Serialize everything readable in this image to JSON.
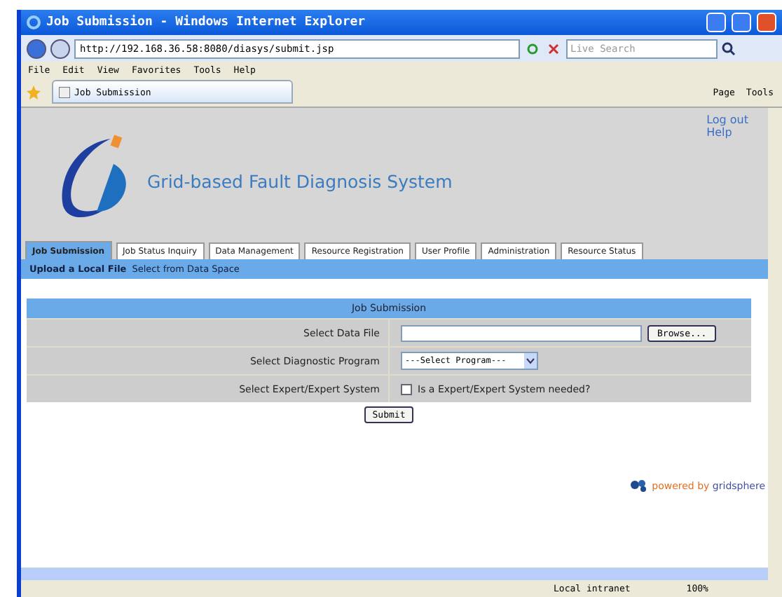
{
  "window": {
    "title": "Job Submission - Windows Internet Explorer"
  },
  "address_bar": {
    "url": "http://192.168.36.58:8080/diasys/submit.jsp",
    "search_placeholder": "Live Search"
  },
  "menu_bar": [
    "File",
    "Edit",
    "View",
    "Favorites",
    "Tools",
    "Help"
  ],
  "browser_tab": {
    "title": "Job Submission"
  },
  "command_bar": [
    {
      "label": "Page"
    },
    {
      "label": "Tools"
    }
  ],
  "page": {
    "title": "Grid-based Fault Diagnosis System",
    "links": [
      "Log out",
      "Help"
    ],
    "tabs": [
      {
        "label": "Job Submission",
        "selected": true
      },
      {
        "label": "Job Status Inquiry",
        "selected": false
      },
      {
        "label": "Data Management",
        "selected": false
      },
      {
        "label": "Resource Registration",
        "selected": false
      },
      {
        "label": "User Profile",
        "selected": false
      },
      {
        "label": "Administration",
        "selected": false
      },
      {
        "label": "Resource Status",
        "selected": false
      }
    ],
    "subtabs": [
      {
        "label": "Upload a Local File",
        "selected": true
      },
      {
        "label": "Select from Data Space",
        "selected": false
      }
    ],
    "form": {
      "heading": "Job Submission",
      "rows": [
        {
          "kind": "file",
          "label": "Select Data File",
          "button": "Browse..."
        },
        {
          "kind": "select",
          "label": "Select Diagnostic Program",
          "value": "---Select Program---"
        },
        {
          "kind": "checkbox",
          "label": "Select Expert/Expert System",
          "text": "Is a Expert/Expert System needed?",
          "checked": false
        }
      ],
      "submit": "Submit"
    },
    "powered_by": {
      "prefix": "powered by",
      "brand": "gridsphere"
    }
  },
  "status_bar": {
    "zone": "Local intranet",
    "zoom": "100%"
  }
}
